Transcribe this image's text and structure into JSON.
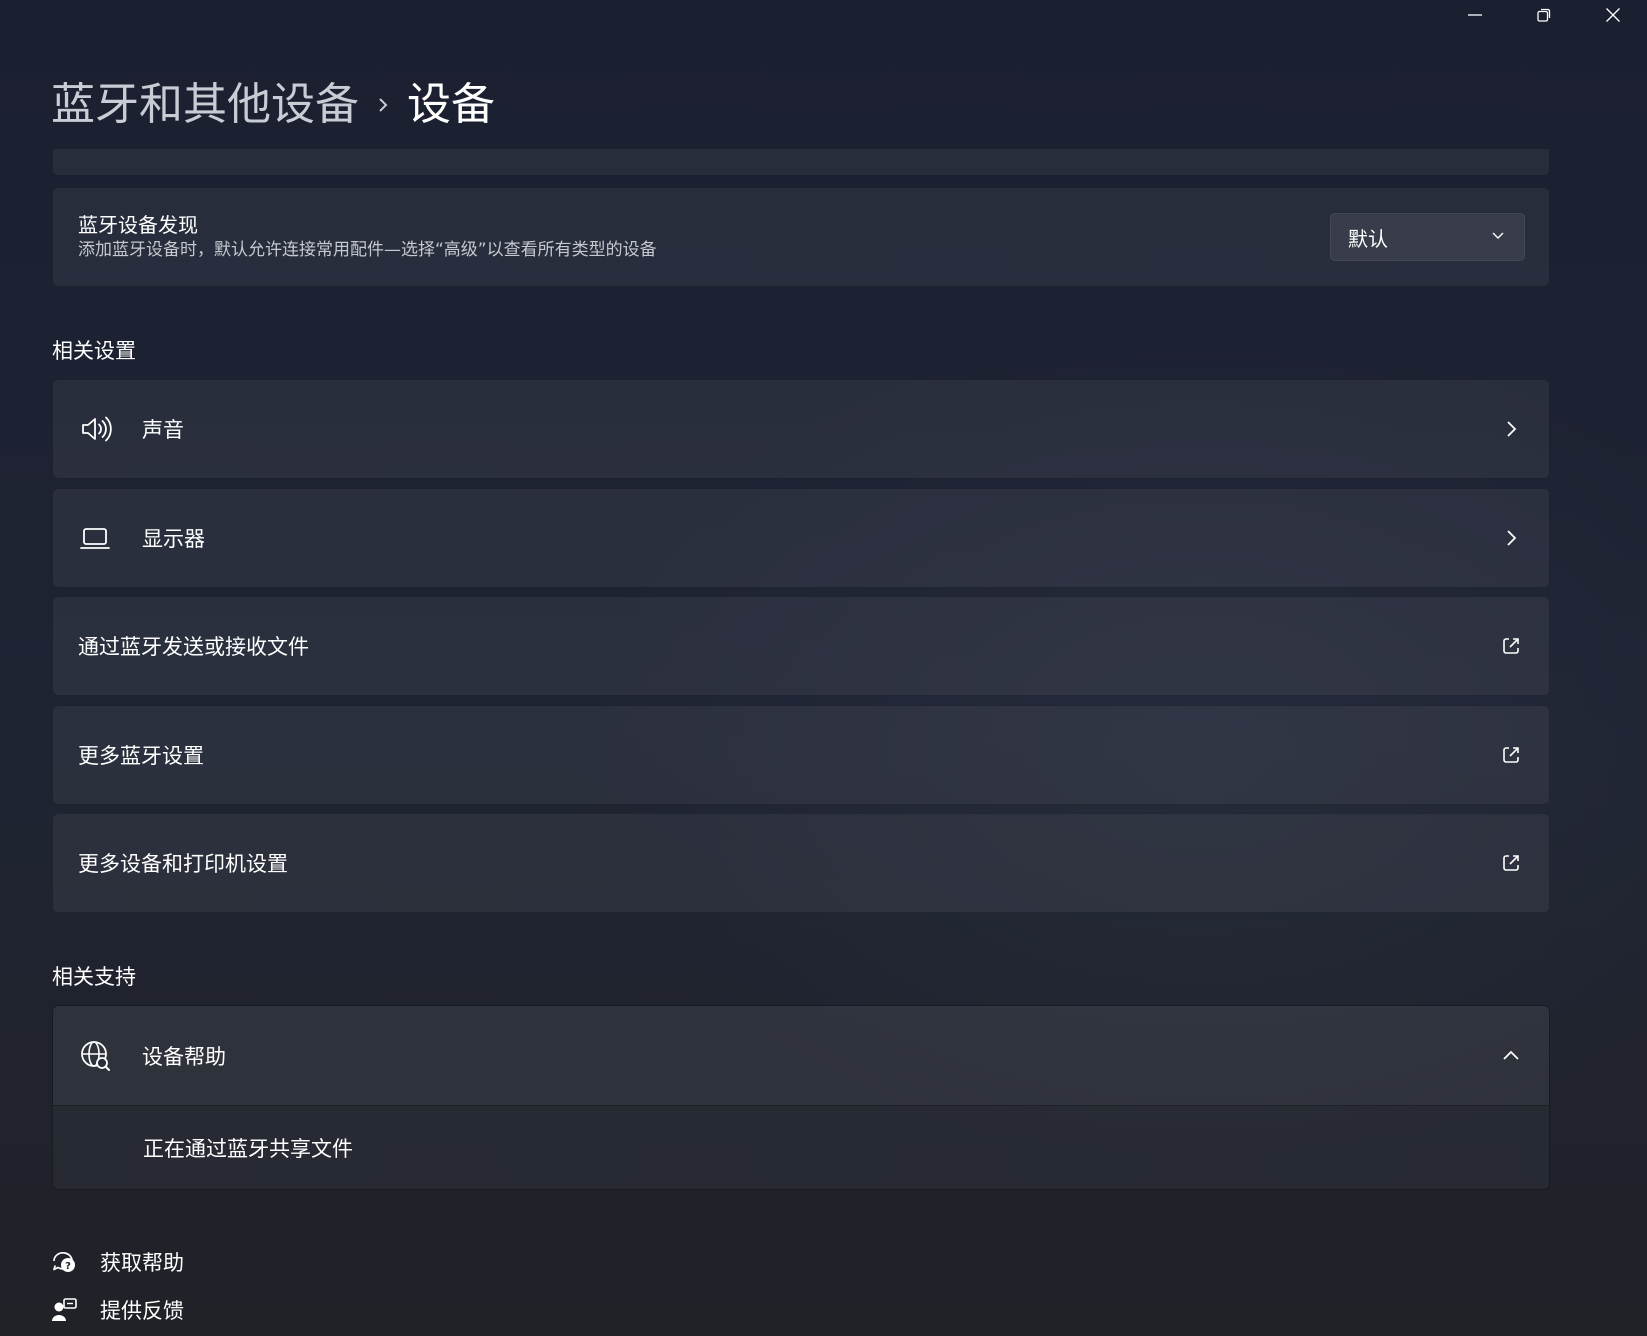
{
  "window": {
    "controls": {
      "minimize_icon": "minimize-icon",
      "restore_icon": "restore-icon",
      "close_icon": "close-icon"
    }
  },
  "breadcrumb": {
    "parent": "蓝牙和其他设备",
    "separator_icon": "chevron-right-icon",
    "current": "设备"
  },
  "bluetooth_discovery": {
    "title": "蓝牙设备发现",
    "description": "添加蓝牙设备时，默认允许连接常用配件—选择“高级”以查看所有类型的设备",
    "dropdown_value": "默认"
  },
  "related_settings": {
    "heading": "相关设置",
    "items": [
      {
        "label": "声音",
        "icon": "speaker-icon",
        "trail": "chevron-right-icon"
      },
      {
        "label": "显示器",
        "icon": "laptop-icon",
        "trail": "chevron-right-icon"
      },
      {
        "label": "通过蓝牙发送或接收文件",
        "trail": "open-external-icon"
      },
      {
        "label": "更多蓝牙设置",
        "trail": "open-external-icon"
      },
      {
        "label": "更多设备和打印机设置",
        "trail": "open-external-icon"
      }
    ]
  },
  "related_support": {
    "heading": "相关支持",
    "expander": {
      "label": "设备帮助",
      "icon": "globe-search-icon",
      "state_icon": "chevron-up-icon",
      "links": [
        "正在通过蓝牙共享文件"
      ]
    }
  },
  "footer": {
    "get_help": "获取帮助",
    "feedback": "提供反馈"
  },
  "colors": {
    "background": "#1c2030",
    "card": "#2a2f3d",
    "text_primary": "#ffffff",
    "text_secondary": "#c5c8cf"
  }
}
